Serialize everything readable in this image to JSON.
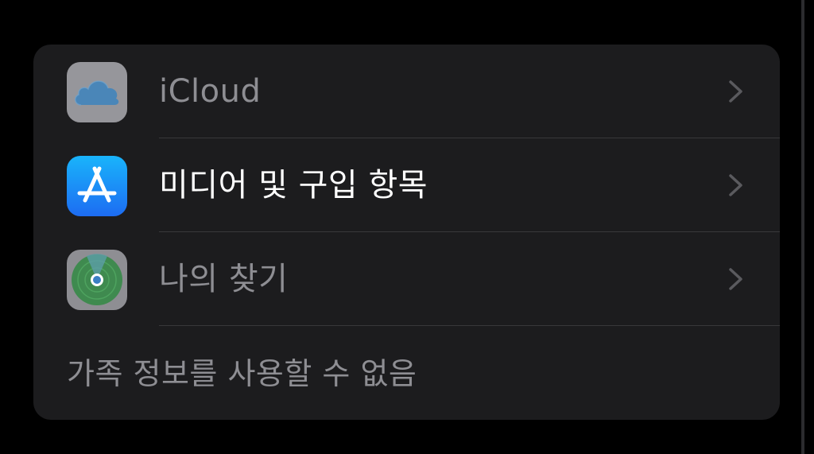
{
  "settings_group": {
    "rows": [
      {
        "label": "iCloud",
        "icon": "icloud-icon",
        "enabled": false
      },
      {
        "label": "미디어 및 구입 항목",
        "icon": "app-store-icon",
        "enabled": true
      },
      {
        "label": "나의 찾기",
        "icon": "find-my-icon",
        "enabled": false
      }
    ],
    "footer_note": "가족 정보를 사용할 수 없음"
  },
  "colors": {
    "background": "#000000",
    "card": "#1c1c1e",
    "text_primary": "#ffffff",
    "text_dimmed": "#8e8e93",
    "separator": "#38383a",
    "chevron": "#5a5a5e",
    "app_store_blue": "#1c7cf5",
    "find_my_green": "#34c759"
  }
}
